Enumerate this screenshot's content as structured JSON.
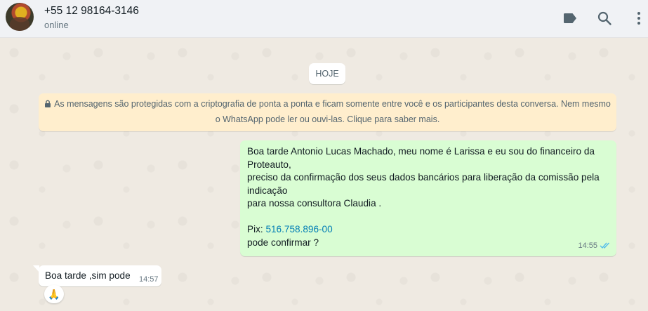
{
  "header": {
    "contact_name": "+55 12 98164-3146",
    "status": "online",
    "icons": [
      "avatar",
      "label-icon",
      "search-icon",
      "menu-icon"
    ]
  },
  "chat": {
    "date_divider": "HOJE",
    "encryption_notice": {
      "line1": "As mensagens são protegidas com a criptografia de ponta a ponta e ficam somente entre você e os participantes desta conversa. Nem mesmo",
      "line2": "o WhatsApp pode ler ou ouvi-las. Clique para saber mais."
    },
    "outgoing_message": {
      "lines": [
        "Boa tarde Antonio Lucas Machado,  meu nome é Larissa e eu sou do financeiro da",
        "Proteauto,",
        "preciso da confirmação dos seus dados bancários para liberação da comissão pela",
        "indicação",
        "para nossa consultora Claudia ."
      ],
      "pix_label": "Pix: ",
      "pix_number": "516.758.896-00",
      "closing": "pode confirmar ?",
      "time": "14:55",
      "status": "read"
    },
    "incoming_message": {
      "text": "Boa tarde ,sim pode",
      "time": "14:57",
      "reaction": "🙏"
    }
  },
  "colors": {
    "header_bg": "#f0f2f5",
    "chat_bg": "#efeae2",
    "outgoing_bubble": "#d9fdd3",
    "incoming_bubble": "#ffffff",
    "encryption_bg": "#ffeecd",
    "read_tick": "#53bdeb",
    "link": "#027eb5"
  }
}
